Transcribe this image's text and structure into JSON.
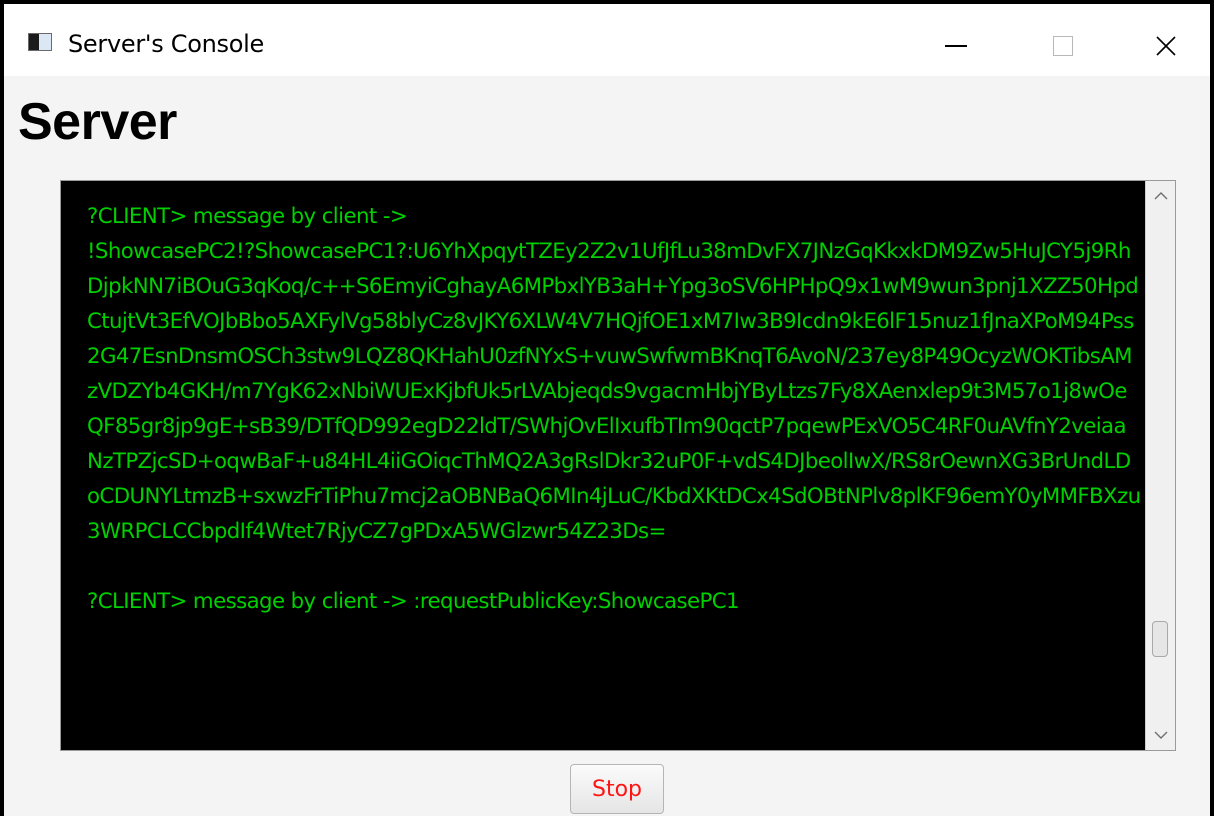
{
  "window": {
    "title": "Server's Console",
    "controls": [
      "minimize-icon",
      "maximize-icon",
      "close-icon"
    ]
  },
  "heading": "Server",
  "console": {
    "text_color": "#00d000",
    "background": "#000000",
    "lines": [
      "?CLIENT> message by client ->",
      "!ShowcasePC2!?ShowcasePC1?:U6YhXpqytTZEy2Z2v1UfJfLu38mDvFX7JNzGqKkxkDM9Zw5HuJCY5j9RhDjpkNN7iBOuG3qKoq/c++S6EmyiCghayA6MPbxlYB3aH+Ypg3oSV6HPHpQ9x1wM9wun3pnj1XZZ50HpdCtujtVt3EfVOJbBbo5AXFylVg58blyCz8vJKY6XLW4V7HQjfOE1xM7Iw3B9Icdn9kE6lF15nuz1fJnaXPoM94Pss2G47EsnDnsmOSCh3stw9LQZ8QKHahU0zfNYxS+vuwSwfwmBKnqT6AvoN/237ey8P49OcyzWOKTibsAMzVDZYb4GKH/m7YgK62xNbiWUExKjbfUk5rLVAbjeqds9vgacmHbjYByLtzs7Fy8XAenxlep9t3M57o1j8wOeQF85gr8jp9gE+sB39/DTfQD992egD22ldT/SWhjOvElIxufbTIm90qctP7pqewPExVO5C4RF0uAVfnY2veiaaNzTPZjcSD+oqwBaF+u84HL4iiGOiqcThMQ2A3gRslDkr32uP0F+vdS4DJbeolIwX/RS8rOewnXG3BrUndLDoCDUNYLtmzB+sxwzFrTiPhu7mcj2aOBNBaQ6MIn4jLuC/KbdXKtDCx4SdOBtNPlv8plKF96emY0yMMFBXzu3WRPCLCCbpdIf4Wtet7RjyCZ7gPDxA5WGlzwr54Z23Ds=",
      "",
      "?CLIENT> message by client -> :requestPublicKey:ShowcasePC1"
    ]
  },
  "stop_button": {
    "label": "Stop",
    "text_color": "#ff1414"
  }
}
